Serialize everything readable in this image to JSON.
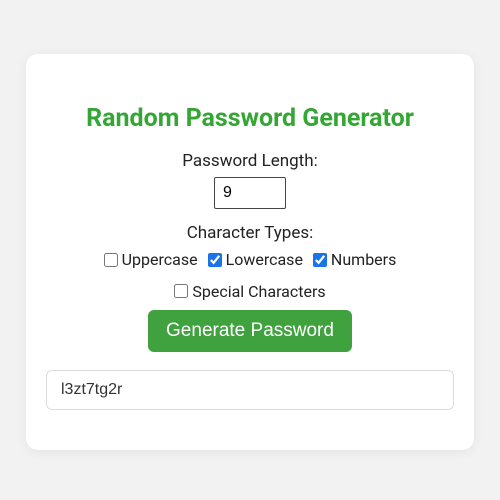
{
  "title": "Random Password Generator",
  "lengthLabel": "Password Length:",
  "lengthValue": "9",
  "charTypesLabel": "Character Types:",
  "options": {
    "uppercase": {
      "label": "Uppercase",
      "checked": false
    },
    "lowercase": {
      "label": "Lowercase",
      "checked": true
    },
    "numbers": {
      "label": "Numbers",
      "checked": true
    },
    "special": {
      "label": "Special Characters",
      "checked": false
    }
  },
  "generateLabel": "Generate Password",
  "output": "l3zt7tg2r"
}
